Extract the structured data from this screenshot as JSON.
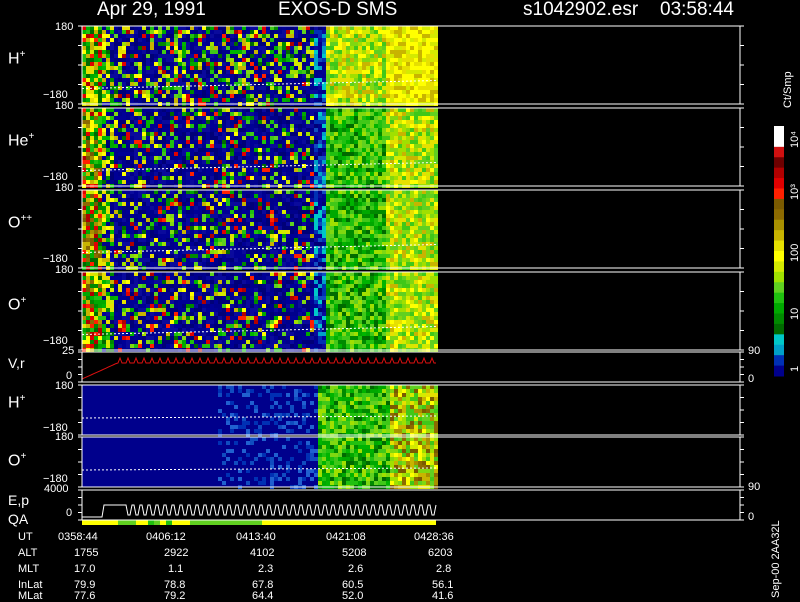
{
  "header": {
    "date": "Apr 29, 1991",
    "instrument": "EXOS-D SMS",
    "file": "s1042902.esr",
    "time": "03:58:44"
  },
  "colorbar": {
    "unit": "Ct/Smp",
    "ticks": [
      "1",
      "10",
      "100",
      "10³",
      "10⁴"
    ],
    "colors": [
      "#ffffff",
      "#ffffff",
      "#d01010",
      "#6e0000",
      "#b00000",
      "#e00000",
      "#ff2000",
      "#7a5a00",
      "#8c6a00",
      "#a89000",
      "#c8b400",
      "#e6e000",
      "#ffff00",
      "#d4ea00",
      "#a0e000",
      "#60d020",
      "#20c010",
      "#00a800",
      "#008a00",
      "#006a00",
      "#00c8c8",
      "#00a0c8",
      "#0030b4",
      "#00008c"
    ]
  },
  "panels": [
    {
      "label": "H",
      "ion": "+",
      "ytop": "180",
      "ybot": "−180"
    },
    {
      "label": "He",
      "ion": "+",
      "ytop": "180",
      "ybot": "−180"
    },
    {
      "label": "O",
      "ion": "++",
      "ytop": "180",
      "ybot": "−180"
    },
    {
      "label": "O",
      "ion": "+",
      "ytop": "180",
      "ybot": "−180"
    }
  ],
  "vr_panel": {
    "label": "V,r",
    "ytop": "25",
    "ybot": "0",
    "right_top": "90",
    "right_bot": "0"
  },
  "lower_panels": [
    {
      "label": "H",
      "ion": "+",
      "ytop": "180",
      "ybot": "−180"
    },
    {
      "label": "O",
      "ion": "+",
      "ytop": "180",
      "ybot": "−180"
    }
  ],
  "ep_panel": {
    "label": "E,p",
    "sub": "QA",
    "ytop": "4000",
    "ybot": "0",
    "right_top": "90",
    "right_bot": "0"
  },
  "footer_version": "Sep-00  2AA32L",
  "orbit_table": {
    "rows": [
      {
        "name": "UT",
        "values": [
          "0358:44",
          "0406:12",
          "0413:40",
          "0421:08",
          "0428:36"
        ]
      },
      {
        "name": "ALT",
        "values": [
          "1755",
          "2922",
          "4102",
          "5208",
          "6203"
        ]
      },
      {
        "name": "MLT",
        "values": [
          "17.0",
          "1.1",
          "2.3",
          "2.6",
          "2.8"
        ]
      },
      {
        "name": "InLat",
        "values": [
          "79.9",
          "78.8",
          "67.8",
          "60.5",
          "56.1"
        ]
      },
      {
        "name": "MLat",
        "values": [
          "77.6",
          "79.2",
          "64.4",
          "52.0",
          "41.6"
        ]
      }
    ]
  },
  "chart_data": {
    "type": "heatmap",
    "x_ticks_ut": [
      "0358:44",
      "0406:12",
      "0413:40",
      "0421:08",
      "0428:36"
    ],
    "panels": [
      "H+",
      "He+",
      "O++",
      "O+",
      "V,r",
      "H+",
      "O+",
      "E,p"
    ],
    "y_range_angle": [
      -180,
      180
    ],
    "vr_range": [
      0,
      25
    ],
    "ep_range": [
      0,
      4000
    ],
    "colorbar_unit": "Ct/Smp",
    "colorbar_range": [
      1,
      10000
    ],
    "log_scale": true
  }
}
